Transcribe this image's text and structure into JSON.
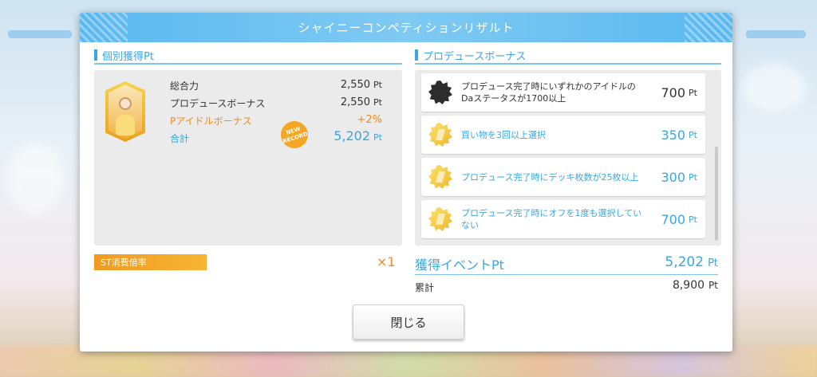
{
  "dialog": {
    "title": "シャイニーコンペティションリザルト",
    "close_label": "閉じる"
  },
  "individual": {
    "section_label": "個別獲得Pt",
    "stats": [
      {
        "label": "総合力",
        "value": "2,550",
        "unit": "Pt"
      },
      {
        "label": "プロデュースボーナス",
        "value": "2,550",
        "unit": "Pt"
      },
      {
        "label": "Pアイドルボーナス",
        "value": "+2%",
        "unit": ""
      },
      {
        "label": "合計",
        "value": "5,202",
        "unit": "Pt"
      }
    ],
    "new_record": {
      "line1": "NEW",
      "line2": "RECORD"
    }
  },
  "produce_bonus": {
    "section_label": "プロデュースボーナス",
    "items": [
      {
        "text": "プロデュース完了時にいずれかのアイドルのDaステータスが1700以上",
        "value": "700",
        "unit": "Pt",
        "icon": "dark-star-badge-icon"
      },
      {
        "text": "買い物を3回以上選択",
        "value": "350",
        "unit": "Pt",
        "icon": "gold-star-badge-icon"
      },
      {
        "text": "プロデュース完了時にデッキ枚数が25枚以上",
        "value": "300",
        "unit": "Pt",
        "icon": "gold-star-badge-icon"
      },
      {
        "text": "プロデュース完了時にオフを1度も選択していない",
        "value": "700",
        "unit": "Pt",
        "icon": "gold-star-badge-icon"
      }
    ]
  },
  "st": {
    "label": "ST消費倍率",
    "multiplier": "×1"
  },
  "event_pt": {
    "label": "獲得イベントPt",
    "value": "5,202",
    "unit": "Pt"
  },
  "cumulative": {
    "label": "累計",
    "value": "8,900",
    "unit": "Pt"
  },
  "colors": {
    "accent_blue": "#3aa6e3",
    "accent_orange": "#f08a22",
    "header_blue": "#5ab8ef"
  }
}
